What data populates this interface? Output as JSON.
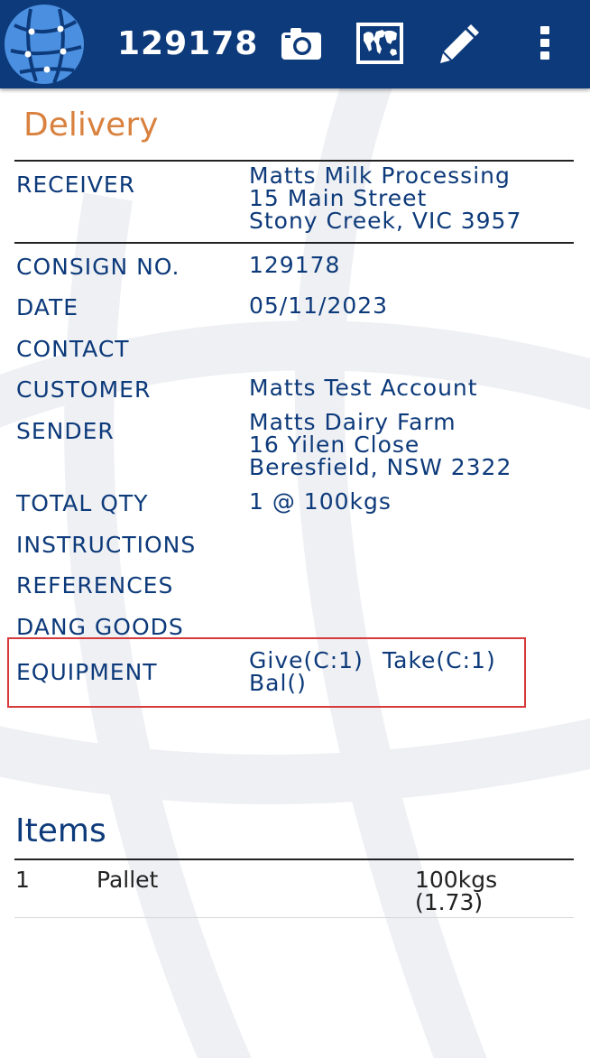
{
  "header": {
    "consignment_id": "129178",
    "icons": [
      "globe-logo-icon",
      "camera-icon",
      "map-icon",
      "pencil-icon",
      "more-vert-icon"
    ],
    "colors": {
      "bar": "#0d3a7a",
      "accent": "#d9823f",
      "label": "#0d3a7a",
      "highlight": "#d63a3a"
    }
  },
  "delivery": {
    "title": "Delivery",
    "receiver": {
      "label": "RECEIVER",
      "line1": "Matts Milk Processing",
      "line2": "15 Main Street",
      "line3": "Stony Creek, VIC 3957"
    },
    "consign_no": {
      "label": "CONSIGN NO.",
      "value": "129178"
    },
    "date": {
      "label": "DATE",
      "value": "05/11/2023"
    },
    "contact": {
      "label": "CONTACT",
      "value": ""
    },
    "customer": {
      "label": "CUSTOMER",
      "value": "Matts Test Account"
    },
    "sender": {
      "label": "SENDER",
      "line1": "Matts Dairy Farm",
      "line2": "16 Yilen Close",
      "line3": "Beresfield, NSW 2322"
    },
    "total_qty": {
      "label": "TOTAL QTY",
      "value": "1 @ 100kgs"
    },
    "instructions": {
      "label": "INSTRUCTIONS",
      "value": ""
    },
    "references": {
      "label": "REFERENCES",
      "value": ""
    },
    "dang_goods": {
      "label": "DANG GOODS",
      "value": ""
    },
    "equipment": {
      "label": "EQUIPMENT",
      "give": "Give(C:1)",
      "take": "Take(C:1)",
      "bal": "Bal()"
    }
  },
  "items": {
    "title": "Items",
    "rows": [
      {
        "qty": "1",
        "description": "Pallet",
        "weight": "100kgs",
        "cubic": "(1.73)"
      }
    ]
  }
}
